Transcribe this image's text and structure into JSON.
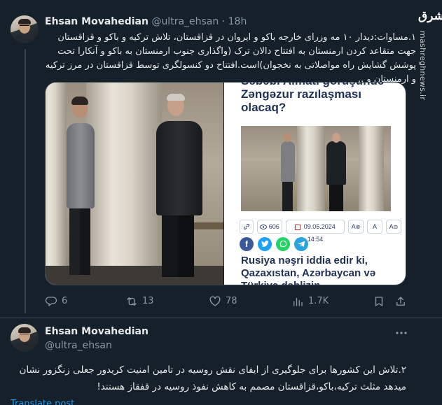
{
  "tweet1": {
    "author_name": "Ehsan Movahedian",
    "handle": "@ultra_ehsan",
    "separator": "·",
    "time": "18h",
    "text": "۱.مساوات:دیدار ۱۰ مه وزرای خارجه باکو و ایروان در قزاقستان، تلاش ترکیه و باکو و قزاقستان جهت متقاعد کردن ارمنستان به افتتاح دالان ترک (واگذاری جنوب ارمنستان به باکو و آنکارا تحت پوشش گشایش راه مواصلاتی به نخجوان)است.افتتاح دو کنسولگری توسط قزاقستان در مرز ترکیه و ارمنستان و ..",
    "media": {
      "article": {
        "title_top": "Səbəbi Almatı görüşündə Zəngəzur razılaşması olacaq?",
        "views": "606",
        "date": "09.05.2024 14:54",
        "body": "Rusiya nəşri iddia edir ki, Qazaxıstan, Azərbaycan və Türkiyə dəhlizin"
      }
    },
    "actions": {
      "replies": "6",
      "retweets": "13",
      "likes": "78",
      "views": "1.7K"
    }
  },
  "tweet2": {
    "author_name": "Ehsan Movahedian",
    "handle": "@ultra_ehsan",
    "text": "۲.تلاش این کشورها برای جلوگیری از ایفای نقش روسیه در تامین امنیت کریدور جعلی زنگزور نشان میدهد مثلث ترکیه،باکو،قزاقستان مصمم به کاهش نفوذ روسیه در قفقاز هستند!",
    "translate_label": "Translate post"
  },
  "watermark": {
    "logo": "مشرق",
    "url": "mashreghnews.ir"
  },
  "colors": {
    "background": "#15202b",
    "text": "#e7e9ea",
    "muted": "#8b98a5",
    "accent": "#1d9bf0"
  }
}
